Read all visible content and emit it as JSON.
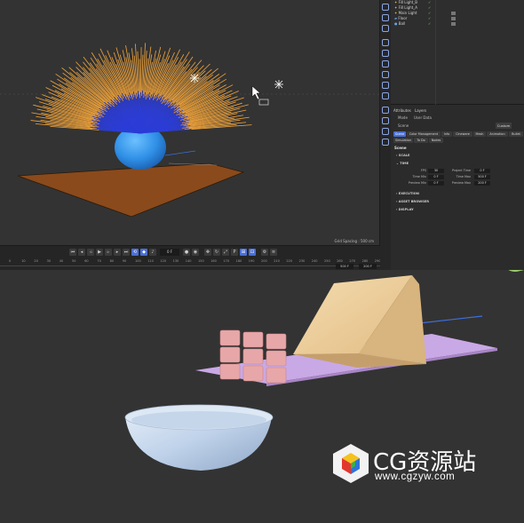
{
  "viewport": {
    "grid_spacing": "Grid Spacing : 500 cm"
  },
  "timeline": {
    "current_frame": "0 F",
    "ruler_ticks": [
      "0",
      "10",
      "20",
      "30",
      "40",
      "50",
      "60",
      "70",
      "80",
      "90",
      "100",
      "110",
      "120",
      "130",
      "140",
      "150",
      "160",
      "170",
      "180",
      "190",
      "200",
      "210",
      "220",
      "230",
      "240",
      "250",
      "260",
      "270",
      "280",
      "290"
    ],
    "range_start": "500 F",
    "range_end": "200 F"
  },
  "object_manager": {
    "objects": [
      {
        "name": "Fill Light_B"
      },
      {
        "name": "Fill Light_A"
      },
      {
        "name": "Main Light"
      },
      {
        "name": "Floor"
      },
      {
        "name": "Ball"
      }
    ]
  },
  "attributes": {
    "tabs_header": [
      "Attributes",
      "Layers"
    ],
    "mode_label": "Mode",
    "mode_value": "User Data",
    "scene_label": "Scene",
    "custom_label": "Custom",
    "tabs": [
      "Scene",
      "Color Management",
      "Info",
      "Cineware",
      "Mesh",
      "Animation",
      "Bullet",
      "Simulation",
      "To Do",
      "Nodes"
    ],
    "section_title": "Scene",
    "groups": {
      "scale": "SCALE",
      "time": "TIME",
      "execution": "EXECUTION",
      "asset_browser": "ASSET BROWSER",
      "display": "DISPLAY"
    },
    "time_props": {
      "fps_label": "FPS",
      "fps_value": "30",
      "project_time_label": "Project Time",
      "project_time_value": "0 F",
      "time_min_label": "Time Min",
      "time_min_value": "0 F",
      "time_max_label": "Time Max",
      "time_max_value": "500 F",
      "preview_min_label": "Preview Min",
      "preview_min_value": "0 F",
      "preview_max_label": "Preview Max",
      "preview_max_value": "200 F"
    }
  },
  "watermark": {
    "title": "CG资源站",
    "url": "www.cgzyw.com"
  },
  "colors": {
    "accent_blue": "#4b6fd2",
    "hair_orange": "#f2a43a",
    "hair_blue": "#2c3dd6",
    "ball_blue": "#2f8fe6",
    "floor_brown": "#8a4a1c",
    "ramp_beige": "#eac99a",
    "platform_lavender": "#c9a8e6",
    "cube_pink": "#e7a7a9",
    "bowl_light_blue": "#c9d9ee"
  }
}
